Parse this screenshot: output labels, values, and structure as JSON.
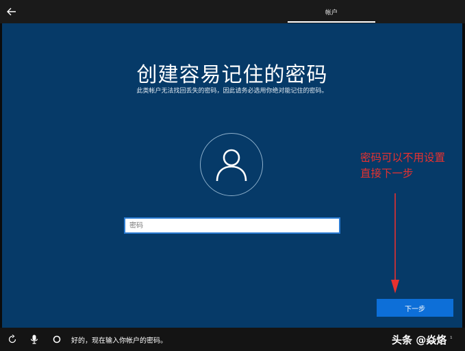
{
  "header": {
    "back_icon": "back-arrow-icon",
    "tab_label": "帐户"
  },
  "main": {
    "title": "创建容易记住的密码",
    "subtitle": "此类帐户无法找回丢失的密码，因此请务必选用你绝对能记住的密码。",
    "avatar_icon": "user-avatar-icon",
    "password_placeholder": "密码",
    "next_button_label": "下一步"
  },
  "annotation": {
    "line1": "密码可以不用设置",
    "line2": "直接下一步",
    "color": "#e8312f"
  },
  "footer": {
    "icons": [
      "accessibility-icon",
      "microphone-icon",
      "cortana-circle-icon"
    ],
    "cortana_message": "好的，现在输入你帐户的密码。",
    "watermark": "头条 @焱烙",
    "tray_char": "¹"
  },
  "colors": {
    "panel_blue": "#063a68",
    "button_blue": "#0d6fd8",
    "input_border": "#2b7cd3"
  }
}
